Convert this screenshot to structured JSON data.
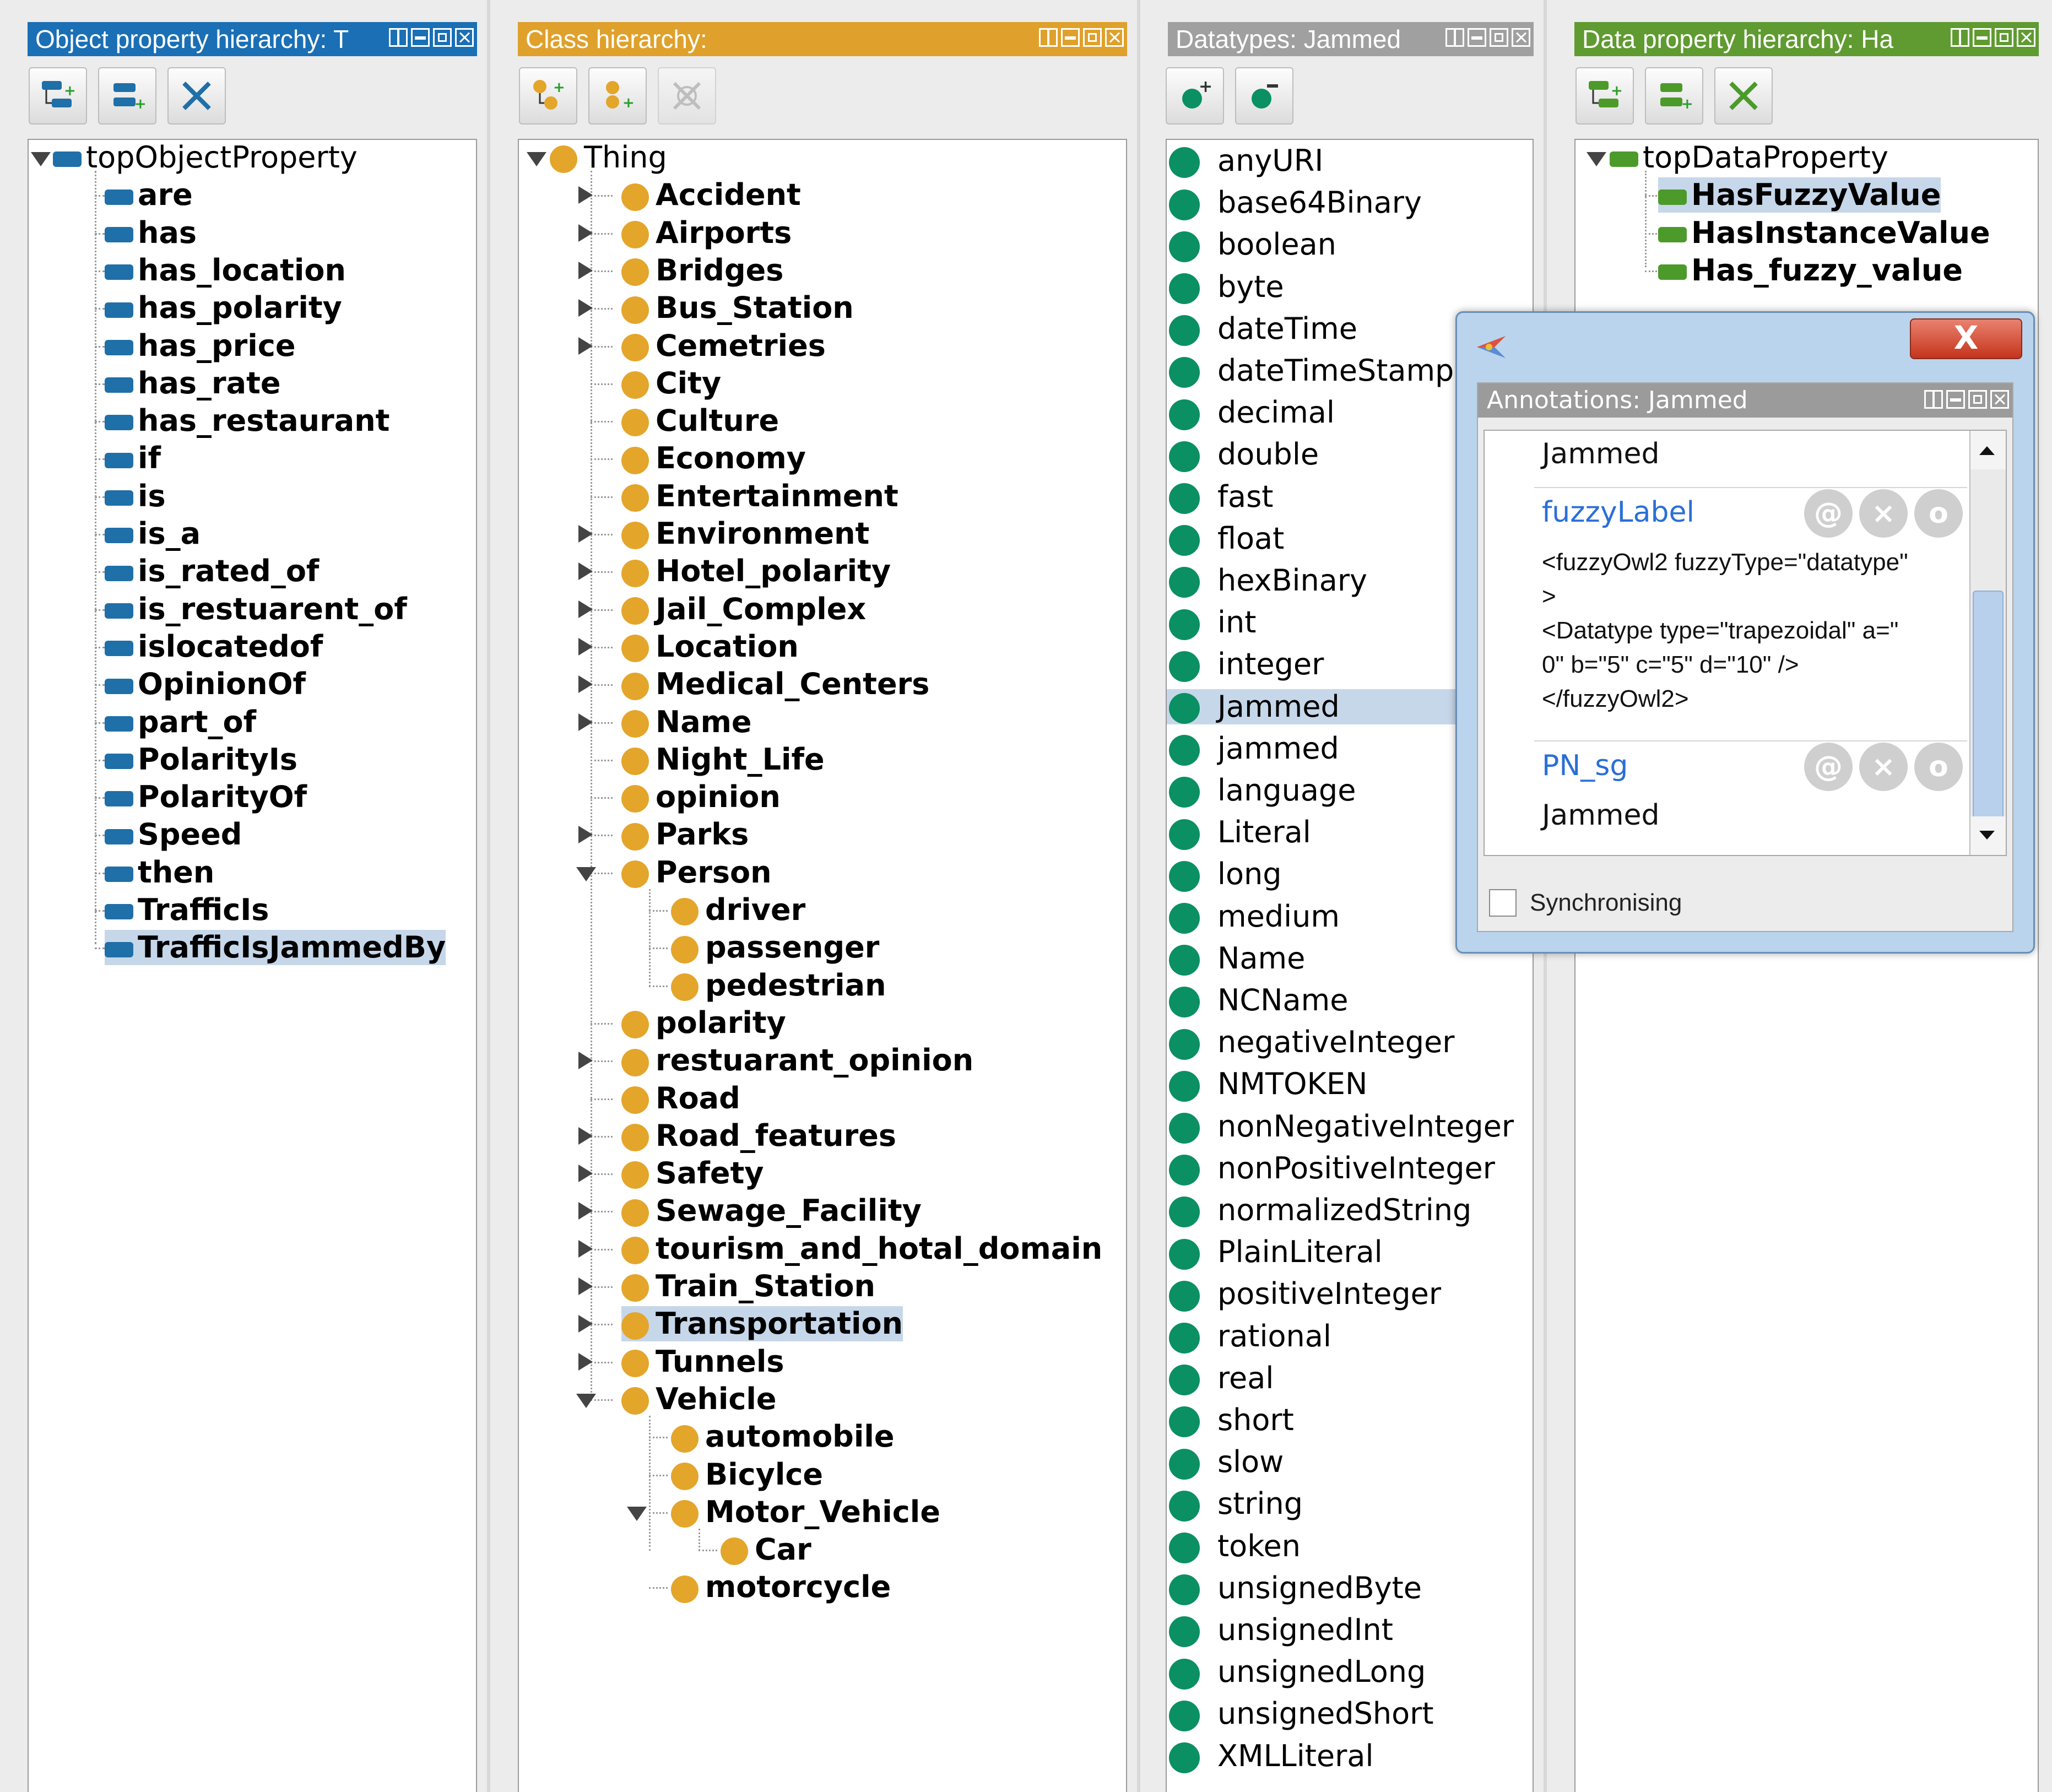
{
  "colors": {
    "object_header": "#1a6fb5",
    "class_header": "#dfa12b",
    "datatype_header": "#a0a0a0",
    "data_header": "#5f9b30"
  },
  "object_panel": {
    "title": "Object property hierarchy: T",
    "root": "topObjectProperty",
    "items": [
      "are",
      "has",
      "has_location",
      "has_polarity",
      "has_price",
      "has_rate",
      "has_restaurant",
      "if",
      "is",
      "is_a",
      "is_rated_of",
      "is_restuarent_of",
      "islocatedof",
      "OpinionOf",
      "part_of",
      "PolarityIs",
      "PolarityOf",
      "Speed",
      "then",
      "TrafficIs",
      "TrafficIsJammedBy"
    ]
  },
  "class_panel": {
    "title": "Class hierarchy:",
    "root": "Thing",
    "items": [
      "Accident",
      "Airports",
      "Bridges",
      "Bus_Station",
      "Cemetries",
      "City",
      "Culture",
      "Economy",
      "Entertainment",
      "Environment",
      "Hotel_polarity",
      "Jail_Complex",
      "Location",
      "Medical_Centers",
      "Name",
      "Night_Life",
      "opinion",
      "Parks",
      "Person",
      "driver",
      "passenger",
      "pedestrian",
      "polarity",
      "restuarant_opinion",
      "Road",
      "Road_features",
      "Safety",
      "Sewage_Facility",
      "tourism_and_hotal_domain",
      "Train_Station",
      "Transportation",
      "Tunnels",
      "Vehicle",
      "automobile",
      "Bicylce",
      "Motor_Vehicle",
      "Car",
      "motorcycle"
    ]
  },
  "datatype_panel": {
    "title": "Datatypes: Jammed",
    "items": [
      "anyURI",
      "base64Binary",
      "boolean",
      "byte",
      "dateTime",
      "dateTimeStamp",
      "decimal",
      "double",
      "fast",
      "float",
      "hexBinary",
      "int",
      "integer",
      "Jammed",
      "jammed",
      "language",
      "Literal",
      "long",
      "medium",
      "Name",
      "NCName",
      "negativeInteger",
      "NMTOKEN",
      "nonNegativeInteger",
      "nonPositiveInteger",
      "normalizedString",
      "PlainLiteral",
      "positiveInteger",
      "rational",
      "real",
      "short",
      "slow",
      "string",
      "token",
      "unsignedByte",
      "unsignedInt",
      "unsignedLong",
      "unsignedShort",
      "XMLLiteral"
    ]
  },
  "data_panel": {
    "title": "Data property hierarchy: Ha",
    "root": "topDataProperty",
    "items": [
      "HasFuzzyValue",
      "HasInstanceValue",
      "Has_fuzzy_value"
    ]
  },
  "popup": {
    "close_label": "X",
    "annotations_title": "Annotations: Jammed",
    "entity_label": "Jammed",
    "prop1": "fuzzyLabel",
    "xml_lines": [
      "<fuzzyOwl2 fuzzyType=\"datatype\"",
      ">",
      "<Datatype type=\"trapezoidal\" a=\"",
      "0\" b=\"5\" c=\"5\" d=\"10\" />",
      "</fuzzyOwl2>"
    ],
    "prop2": "PN_sg",
    "prop2_value": "Jammed",
    "icon_at": "@",
    "icon_x": "×",
    "icon_o": "o",
    "sync_label": "Synchronising"
  }
}
